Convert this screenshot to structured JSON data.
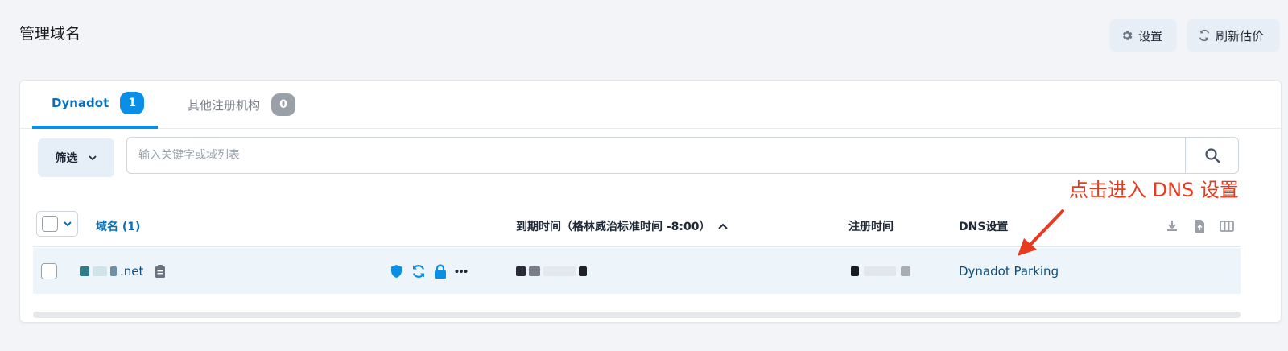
{
  "header": {
    "title": "管理域名",
    "settings_label": "设置",
    "refresh_label": "刷新估价"
  },
  "tabs": [
    {
      "label": "Dynadot",
      "count": "1"
    },
    {
      "label": "其他注册机构",
      "count": "0"
    }
  ],
  "filter": {
    "label": "筛选"
  },
  "search": {
    "placeholder": "输入关键字或域列表"
  },
  "annotation": "点击进入 DNS 设置",
  "table": {
    "columns": {
      "domain": "域名 (1)",
      "expiry": "到期时间（格林威治标准时间 -8:00）",
      "registered": "注册时间",
      "dns": "DNS设置"
    },
    "rows": [
      {
        "domain_suffix": ".net",
        "dns": "Dynadot Parking"
      }
    ]
  },
  "colors": {
    "accent": "#0a8fe6",
    "link": "#0b4f80",
    "annotation": "#e83a1e"
  }
}
